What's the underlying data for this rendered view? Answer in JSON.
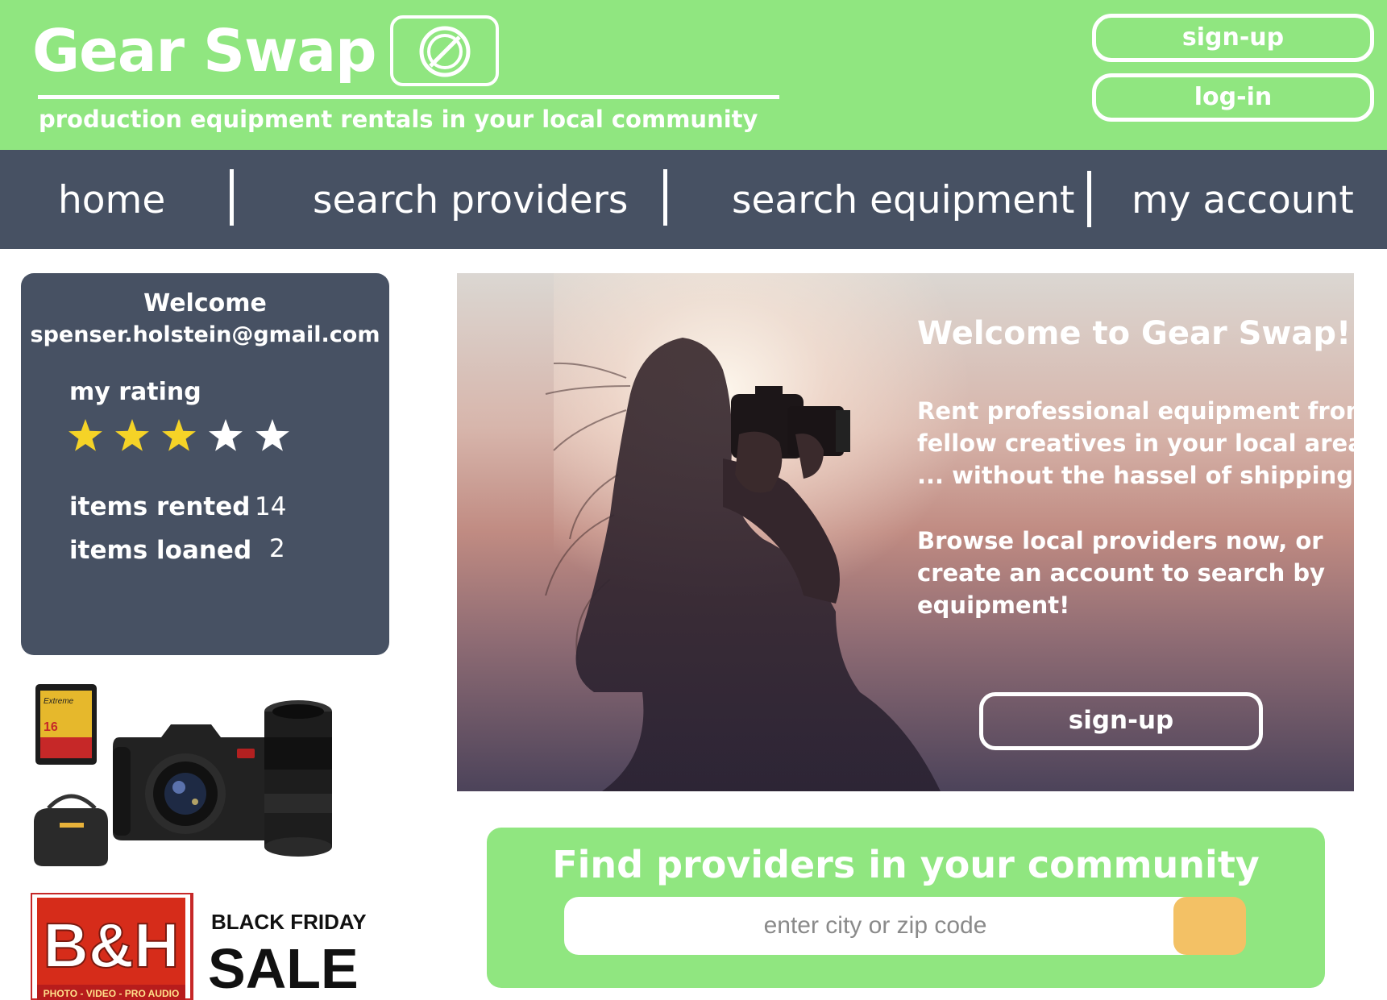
{
  "header": {
    "title": "Gear Swap",
    "tagline": "production equipment rentals in your local community",
    "logo_icon": "no-entry-circle-icon",
    "signup_label": "sign-up",
    "login_label": "log-in",
    "bg_color": "#90e680"
  },
  "nav": {
    "items": [
      {
        "label": "home"
      },
      {
        "label": "search providers"
      },
      {
        "label": "search equipment"
      },
      {
        "label": "my account"
      }
    ],
    "bg_color": "#475163"
  },
  "profile": {
    "welcome": "Welcome",
    "email": "spenser.holstein@gmail.com",
    "rating_label": "my rating",
    "rating": 3,
    "rating_max": 5,
    "star_filled_color": "#f5d327",
    "star_empty_color": "#ffffff",
    "stats": [
      {
        "label": "items rented",
        "value": "14"
      },
      {
        "label": "items loaned",
        "value": "2"
      }
    ]
  },
  "ads": {
    "products_icon": "camera-gear-products-image",
    "sd_card_text": [
      "Extreme",
      "16"
    ],
    "bh_logo_text": "B&H",
    "bh_sub_text": "PHOTO - VIDEO - PRO AUDIO",
    "sale_line1": "BLACK FRIDAY",
    "sale_line2": "SALE"
  },
  "hero": {
    "title": "Welcome to Gear Swap!",
    "paragraph1": [
      "Rent professional equipment from",
      "fellow creatives in your local area",
      "... without the hassel of shipping!"
    ],
    "paragraph2": [
      "Browse local providers now, or",
      "create an account to search  by",
      "equipment!"
    ],
    "signup_label": "sign-up"
  },
  "finder": {
    "title": "Find providers in your community",
    "placeholder": "enter city or zip code",
    "value": "",
    "go_button_color": "#f3c165"
  }
}
